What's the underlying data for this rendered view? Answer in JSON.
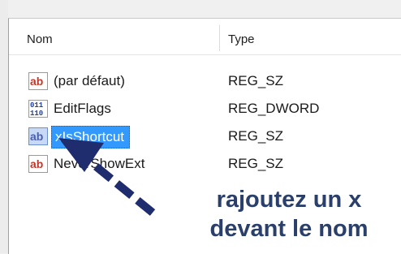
{
  "columns": {
    "name_label": "Nom",
    "type_label": "Type"
  },
  "rows": [
    {
      "icon": "string-value-icon",
      "name": "(par défaut)",
      "type": "REG_SZ",
      "selected": false
    },
    {
      "icon": "binary-value-icon",
      "name": "EditFlags",
      "type": "REG_DWORD",
      "selected": false
    },
    {
      "icon": "string-value-icon",
      "name": "xIsShortcut",
      "type": "REG_SZ",
      "selected": true
    },
    {
      "icon": "string-value-icon",
      "name": "NeverShowExt",
      "type": "REG_SZ",
      "selected": false
    }
  ],
  "annotation": {
    "line1": "rajoutez un x",
    "line2": "devant le nom"
  },
  "colors": {
    "selection": "#3399ff",
    "annotation": "#2a3f6a",
    "arrow": "#1f2c6e"
  }
}
